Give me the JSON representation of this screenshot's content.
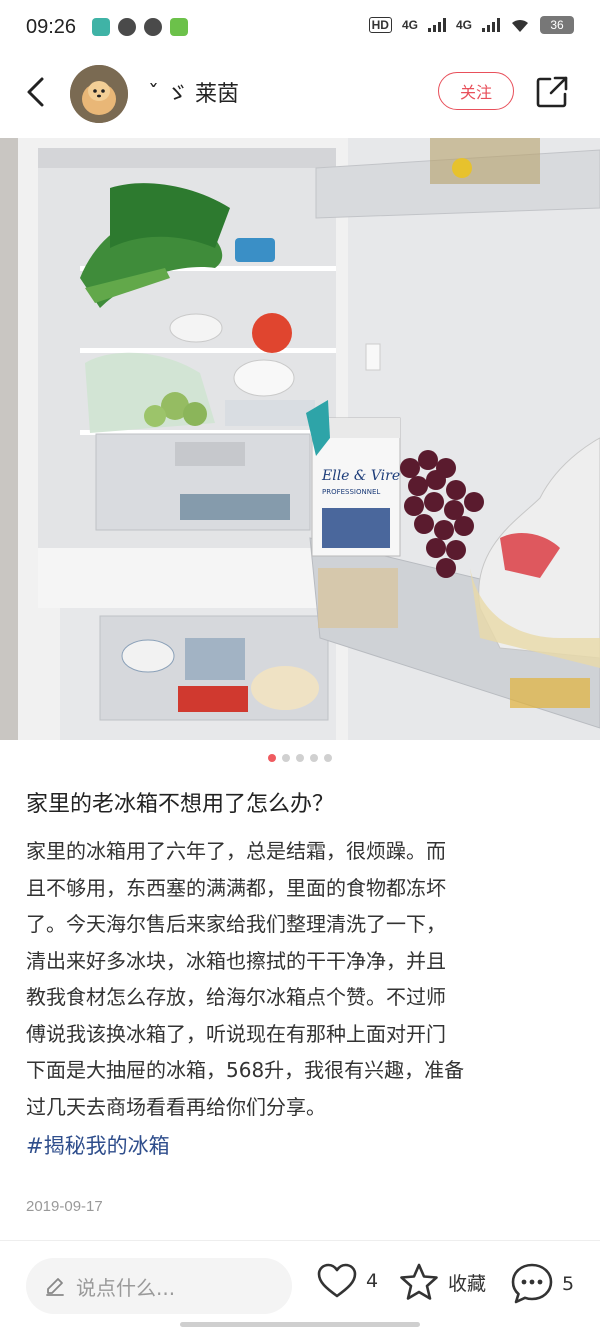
{
  "status_bar": {
    "time": "09:26",
    "signal_labels": [
      "HD",
      "4G",
      "4G"
    ],
    "battery": "36"
  },
  "header": {
    "username": "ˇ ゞ 莱茵",
    "follow_label": "关注"
  },
  "carousel": {
    "total": 5,
    "active_index": 0
  },
  "post": {
    "title": "家里的老冰箱不想用了怎么办？",
    "body_lines": [
      "家里的冰箱用了六年了，总是结霜，很烦躁。而",
      "且不够用，东西塞的满满都，里面的食物都冻坏",
      "了。今天海尔售后来家给我们整理清洗了一下，",
      "清出来好多冰块，冰箱也擦拭的干干净净，并且",
      "教我食材怎么存放，给海尔冰箱点个赞。不过师",
      "傅说我该换冰箱了，听说现在有那种上面对开门",
      "下面是大抽屉的冰箱，568升，我很有兴趣，准备",
      "过几天去商场看看再给你们分享。"
    ],
    "tag": "#揭秘我的冰箱",
    "date": "2019-09-17"
  },
  "bottom_bar": {
    "comment_placeholder": "说点什么...",
    "like_count": "4",
    "favorite_label": "收藏",
    "comment_count": "5"
  },
  "photo": {
    "milk_brand": "Elle & Vire",
    "milk_sub": "PROFESSIONNEL"
  },
  "colors": {
    "accent": "#e8505b",
    "tag": "#2f4e8c",
    "text": "#222222"
  }
}
